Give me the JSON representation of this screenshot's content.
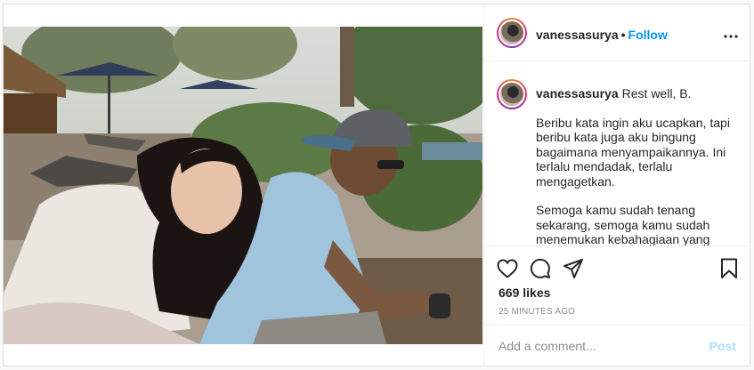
{
  "post": {
    "username": "vanessasurya",
    "separator": "•",
    "follow_label": "Follow",
    "more_label": "•••",
    "caption": {
      "username": "vanessasurya",
      "first_line": "Rest well, B.",
      "paragraph1": "Beribu kata ingin aku ucapkan, tapi beribu kata juga aku bingung bagaimana menyampaikannya. Ini terlalu mendadak, terlalu mengagetkan.",
      "paragraph2": "Semoga kamu sudah tenang sekarang, semoga kamu sudah menemukan kebahagiaan yang kamu cari, tidak ada lagi rasa sakit."
    },
    "likes": "669 likes",
    "time": "25 MINUTES AGO",
    "comment_placeholder": "Add a comment...",
    "post_label": "Post"
  },
  "icons": {
    "like": "heart-icon",
    "comment": "comment-bubble-icon",
    "share": "paper-plane-icon",
    "save": "bookmark-icon",
    "more": "ellipsis-icon"
  },
  "colors": {
    "link": "#0095f6",
    "post_disabled": "#b2dffc",
    "text": "#262626",
    "muted": "#8e8e8e",
    "border": "#dbdbdb"
  }
}
